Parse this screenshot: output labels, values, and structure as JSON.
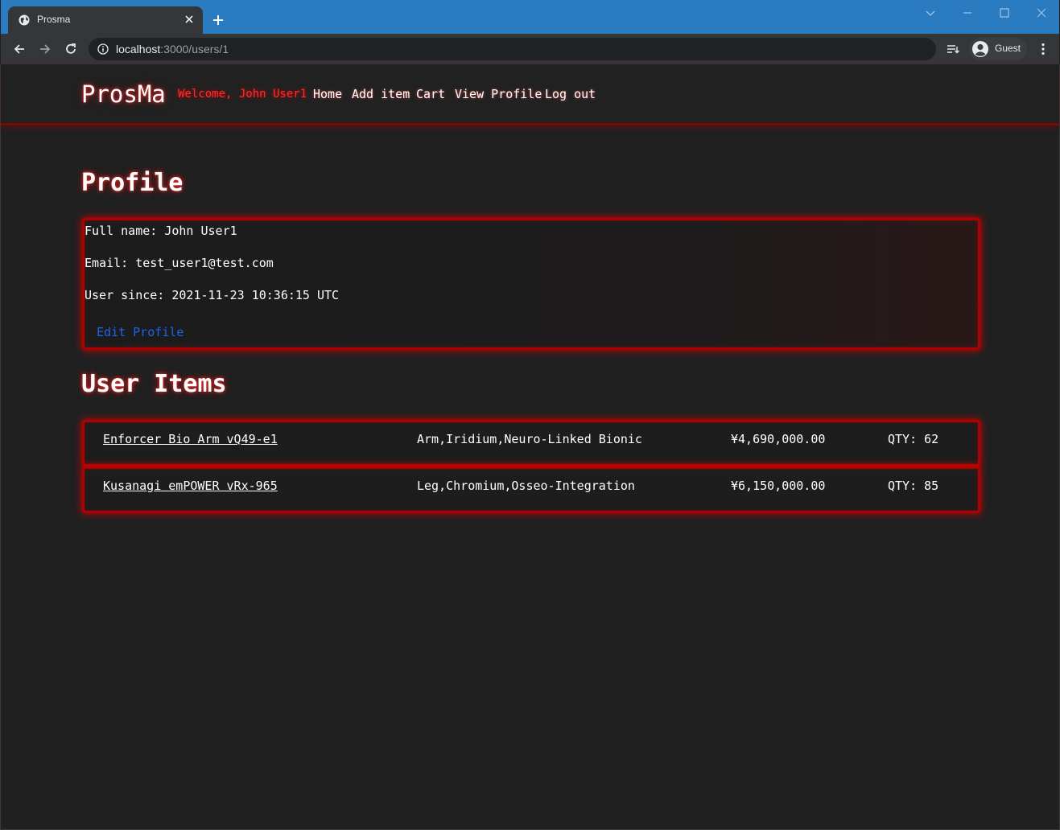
{
  "browser": {
    "tab_title": "Prosma",
    "url_host": "localhost",
    "url_path": ":3000/users/1",
    "profile_label": "Guest",
    "accent_color": "#2a7bbf"
  },
  "navbar": {
    "brand": "ProsMa",
    "welcome": "Welcome, John User1",
    "links": [
      "Home",
      "Add item",
      "Cart",
      "View Profile",
      "Log out"
    ]
  },
  "profile": {
    "title": "Profile",
    "full_name_line": "Full name: John User1",
    "email_line": "Email: test_user1@test.com",
    "since_line": "User since: 2021-11-23 10:36:15 UTC",
    "edit_label": "Edit Profile"
  },
  "user_items": {
    "title": "User Items",
    "items": [
      {
        "name": "Enforcer Bio Arm vQ49-e1",
        "tags": "Arm,Iridium,Neuro-Linked Bionic",
        "price": "¥4,690,000.00",
        "qty": "QTY: 62"
      },
      {
        "name": "Kusanagi emPOWER vRx-965",
        "tags": "Leg,Chromium,Osseo-Integration",
        "price": "¥6,150,000.00",
        "qty": "QTY: 85"
      }
    ]
  },
  "colors": {
    "glow_red": "#e00000",
    "link_blue": "#1e63e9",
    "background": "#202020"
  }
}
